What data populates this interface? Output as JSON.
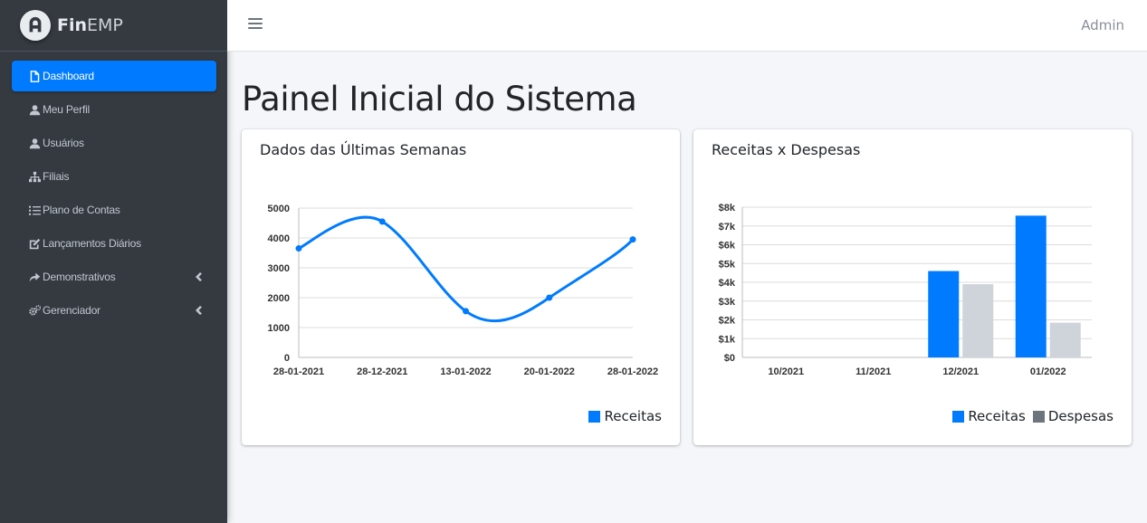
{
  "brand": {
    "name_bold": "Fin",
    "name_rest": "EMP"
  },
  "sidebar": {
    "items": [
      {
        "label": "Dashboard",
        "icon": "file-icon",
        "active": true
      },
      {
        "label": "Meu Perfil",
        "icon": "user-icon"
      },
      {
        "label": "Usuários",
        "icon": "user-icon"
      },
      {
        "label": "Filiais",
        "icon": "sitemap-icon"
      },
      {
        "label": "Plano de Contas",
        "icon": "list-icon"
      },
      {
        "label": "Lançamentos Diários",
        "icon": "edit-icon"
      },
      {
        "label": "Demonstrativos",
        "icon": "share-icon",
        "chevron": true
      },
      {
        "label": "Gerenciador",
        "icon": "cogs-icon",
        "chevron": true
      }
    ]
  },
  "topbar": {
    "user": "Admin"
  },
  "page": {
    "title": "Painel Inicial do Sistema"
  },
  "colors": {
    "primary": "#007bff",
    "secondary": "#ced4da",
    "legend_secondary": "#6c757d",
    "sidebar": "#343a40"
  },
  "cards": {
    "left": {
      "title": "Dados das Últimas Semanas",
      "legend": [
        "Receitas"
      ]
    },
    "right": {
      "title": "Receitas x Despesas",
      "legend": [
        "Receitas",
        "Despesas"
      ]
    }
  },
  "chart_data": [
    {
      "type": "line",
      "categories": [
        "28-01-2021",
        "28-12-2021",
        "13-01-2022",
        "20-01-2022",
        "28-01-2022"
      ],
      "series": [
        {
          "name": "Receitas",
          "values": [
            3650,
            4550,
            1550,
            2000,
            3950
          ]
        }
      ],
      "ylim": [
        0,
        5000
      ],
      "yticks": [
        "0",
        "1000",
        "2000",
        "3000",
        "4000",
        "5000"
      ],
      "grid": true,
      "legend": "bottom-right"
    },
    {
      "type": "bar",
      "categories": [
        "10/2021",
        "11/2021",
        "12/2021",
        "01/2022"
      ],
      "series": [
        {
          "name": "Receitas",
          "values": [
            0,
            0,
            4600,
            7550
          ]
        },
        {
          "name": "Despesas",
          "values": [
            0,
            0,
            3900,
            1850
          ]
        }
      ],
      "ylim": [
        0,
        8000
      ],
      "yticks": [
        "$0",
        "$1k",
        "$2k",
        "$3k",
        "$4k",
        "$5k",
        "$6k",
        "$7k",
        "$8k"
      ],
      "grid": true,
      "legend": "bottom-right"
    }
  ]
}
